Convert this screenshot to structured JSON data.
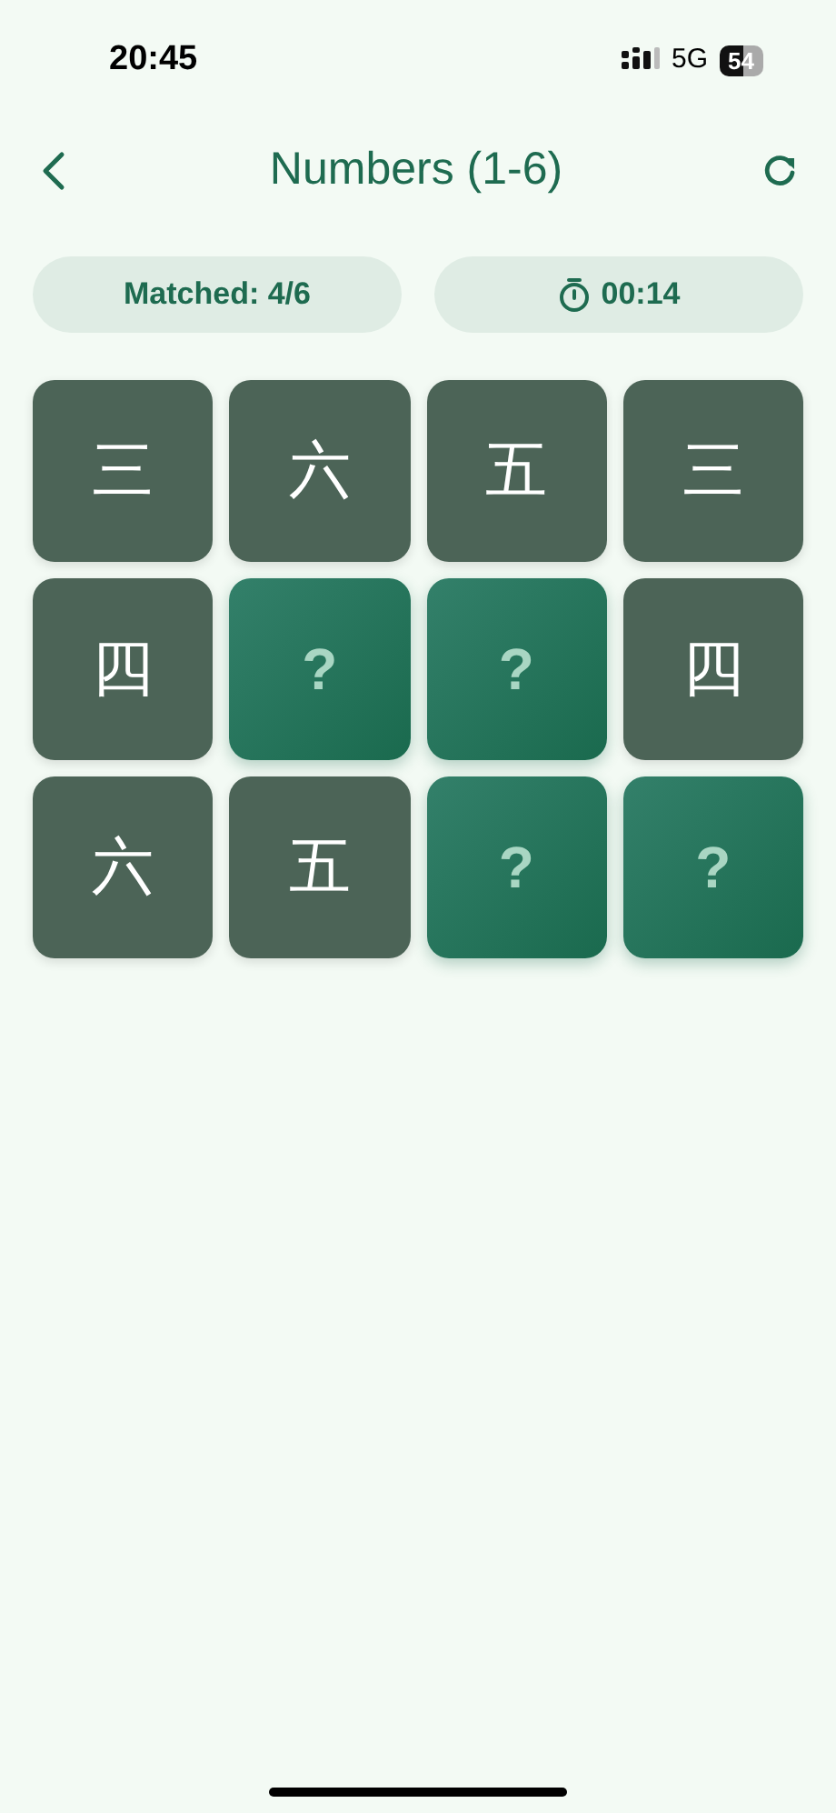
{
  "status_bar": {
    "time": "20:45",
    "network": "5G",
    "battery": "54"
  },
  "header": {
    "title": "Numbers (1-6)"
  },
  "stats": {
    "matched": "Matched: 4/6",
    "timer": "00:14"
  },
  "cards": [
    {
      "label": "三",
      "matched": true
    },
    {
      "label": "六",
      "matched": true
    },
    {
      "label": "五",
      "matched": true
    },
    {
      "label": "三",
      "matched": true
    },
    {
      "label": "四",
      "matched": true
    },
    {
      "label": "?",
      "matched": false
    },
    {
      "label": "?",
      "matched": false
    },
    {
      "label": "四",
      "matched": true
    },
    {
      "label": "六",
      "matched": true
    },
    {
      "label": "五",
      "matched": true
    },
    {
      "label": "?",
      "matched": false
    },
    {
      "label": "?",
      "matched": false
    }
  ]
}
